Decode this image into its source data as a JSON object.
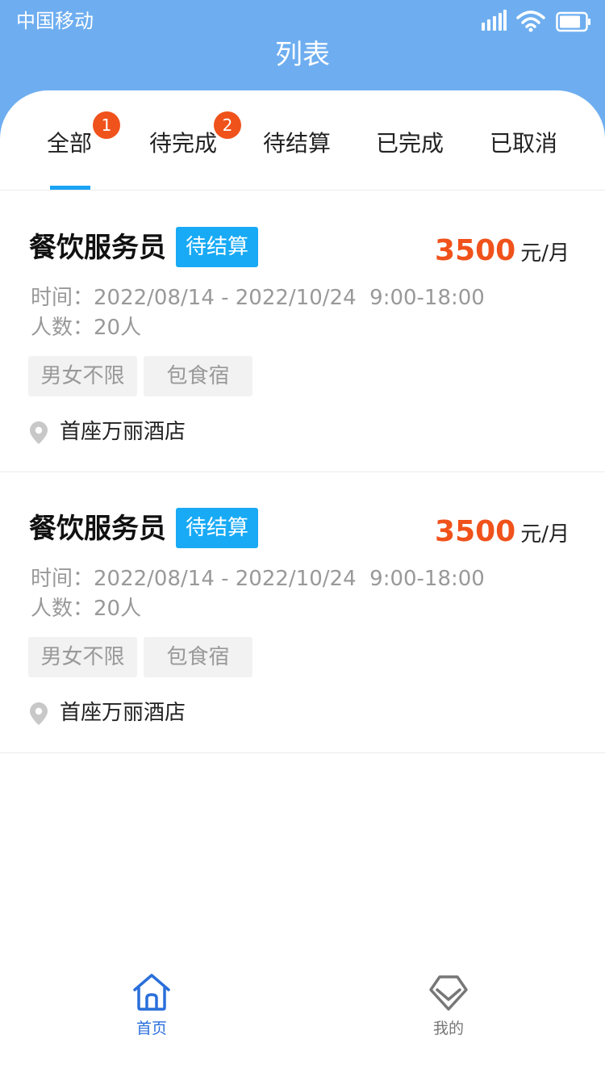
{
  "status_bar": {
    "carrier": "中国移动",
    "icons": [
      "signal-icon",
      "wifi-icon",
      "battery-icon"
    ]
  },
  "header": {
    "title": "列表",
    "background_color": "#6eaef0"
  },
  "tabs": [
    {
      "label": "全部",
      "badge": "1",
      "active": true
    },
    {
      "label": "待完成",
      "badge": "2",
      "active": false
    },
    {
      "label": "待结算",
      "active": false
    },
    {
      "label": "已完成",
      "active": false
    },
    {
      "label": "已取消",
      "active": false
    }
  ],
  "colors": {
    "accent": "#1aa3f5",
    "badge": "#f0521b",
    "salary": "#f0521b",
    "status_tag": "#18aaf5"
  },
  "jobs": [
    {
      "title": "餐饮服务员",
      "status": "待结算",
      "salary_amount": "3500",
      "salary_unit": "元/月",
      "time": "时间：2022/08/14 - 2022/10/24  9:00-18:00",
      "headcount": "人数：20人",
      "tags": [
        "男女不限",
        "包食宿"
      ],
      "location": "首座万丽酒店"
    },
    {
      "title": "餐饮服务员",
      "status": "待结算",
      "salary_amount": "3500",
      "salary_unit": "元/月",
      "time": "时间：2022/08/14 - 2022/10/24  9:00-18:00",
      "headcount": "人数：20人",
      "tags": [
        "男女不限",
        "包食宿"
      ],
      "location": "首座万丽酒店"
    }
  ],
  "bottom_nav": [
    {
      "label": "首页",
      "icon": "home-icon",
      "active": true
    },
    {
      "label": "我的",
      "icon": "diamond-icon",
      "active": false
    }
  ]
}
